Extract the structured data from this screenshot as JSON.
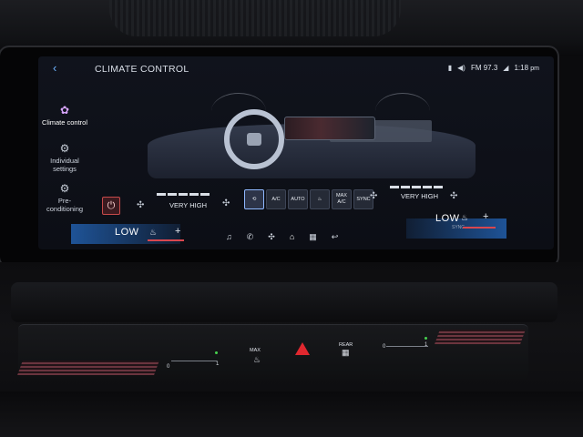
{
  "screen": {
    "title": "CLIMATE CONTROL",
    "back_icon": "back-chevron-icon",
    "status": {
      "radio": "FM 97.3",
      "time": "1:18",
      "time_suffix": "pm"
    }
  },
  "nav": {
    "items": [
      {
        "label": "Climate control",
        "icon": "climate-icon",
        "active": true
      },
      {
        "label": "Individual settings",
        "icon": "individual-settings-icon",
        "active": false
      },
      {
        "label": "Pre- conditioning",
        "icon": "preconditioning-icon",
        "active": false
      }
    ]
  },
  "controls": {
    "power_icon": "power-icon",
    "left_fan_level": "VERY HIGH",
    "right_fan_level": "VERY HIGH",
    "buttons": [
      {
        "label": "",
        "icon": "recirculation-icon"
      },
      {
        "label": "A/C"
      },
      {
        "label": "AUTO"
      },
      {
        "label": "",
        "icon": "defrost-icon"
      },
      {
        "label": "MAX A/C"
      },
      {
        "label": "SYNC"
      }
    ]
  },
  "bottom": {
    "left_temp": "LOW",
    "right_temp": "LOW",
    "sync_label": "SYNC",
    "nav_icons": [
      "music-icon",
      "phone-icon",
      "fan-icon",
      "home-icon",
      "apps-icon",
      "call-icon"
    ]
  },
  "console": {
    "max_label": "MAX",
    "rear_label": "REAR",
    "left_scale_start": "0",
    "left_scale_end": "1",
    "right_scale_start": "0",
    "right_scale_end": "1"
  }
}
